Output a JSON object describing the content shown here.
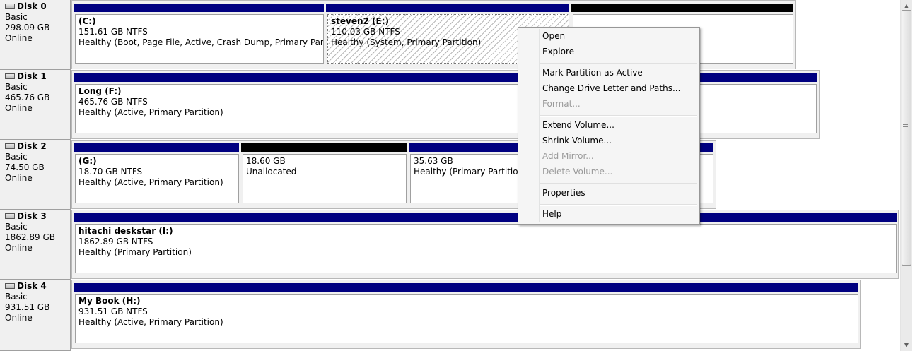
{
  "disks": [
    {
      "name": "Disk 0",
      "type": "Basic",
      "size": "298.09 GB",
      "status": "Online",
      "partitions": [
        {
          "title": "(C:)",
          "size_fs": "151.61 GB NTFS",
          "status": "Healthy (Boot, Page File, Active, Crash Dump, Primary Partition)"
        },
        {
          "title": "steven2  (E:)",
          "size_fs": "110.03 GB NTFS",
          "status": "Healthy (System, Primary Partition)"
        },
        {
          "title": "",
          "size_fs": "",
          "status": ""
        }
      ]
    },
    {
      "name": "Disk 1",
      "type": "Basic",
      "size": "465.76 GB",
      "status": "Online",
      "partitions": [
        {
          "title": "Long  (F:)",
          "size_fs": "465.76 GB NTFS",
          "status": "Healthy (Active, Primary Partition)"
        }
      ]
    },
    {
      "name": "Disk 2",
      "type": "Basic",
      "size": "74.50 GB",
      "status": "Online",
      "partitions": [
        {
          "title": "(G:)",
          "size_fs": "18.70 GB NTFS",
          "status": "Healthy (Active, Primary Partition)"
        },
        {
          "title": "",
          "size_fs": "18.60 GB",
          "status": "Unallocated"
        },
        {
          "title": "",
          "size_fs": "35.63 GB",
          "status": "Healthy (Primary Partition)"
        }
      ]
    },
    {
      "name": "Disk 3",
      "type": "Basic",
      "size": "1862.89 GB",
      "status": "Online",
      "partitions": [
        {
          "title": "hitachi deskstar  (I:)",
          "size_fs": "1862.89 GB NTFS",
          "status": "Healthy (Primary Partition)"
        }
      ]
    },
    {
      "name": "Disk 4",
      "type": "Basic",
      "size": "931.51 GB",
      "status": "Online",
      "partitions": [
        {
          "title": "My Book  (H:)",
          "size_fs": "931.51 GB NTFS",
          "status": "Healthy (Active, Primary Partition)"
        }
      ]
    }
  ],
  "context_menu": {
    "items": [
      {
        "label": "Open",
        "enabled": true
      },
      {
        "label": "Explore",
        "enabled": true
      },
      {
        "label": "Mark Partition as Active",
        "enabled": true
      },
      {
        "label": "Change Drive Letter and Paths...",
        "enabled": true
      },
      {
        "label": "Format...",
        "enabled": false
      },
      {
        "label": "Extend Volume...",
        "enabled": true
      },
      {
        "label": "Shrink Volume...",
        "enabled": true
      },
      {
        "label": "Add Mirror...",
        "enabled": false
      },
      {
        "label": "Delete Volume...",
        "enabled": false
      },
      {
        "label": "Properties",
        "enabled": true
      },
      {
        "label": "Help",
        "enabled": true
      }
    ]
  },
  "colors": {
    "primary_partition_bar": "#000080",
    "unallocated_bar": "#000000"
  },
  "icons": {
    "disk": "hard-disk-icon",
    "scroll_up": "scroll-up-arrow-icon",
    "scroll_down": "scroll-down-arrow-icon"
  }
}
